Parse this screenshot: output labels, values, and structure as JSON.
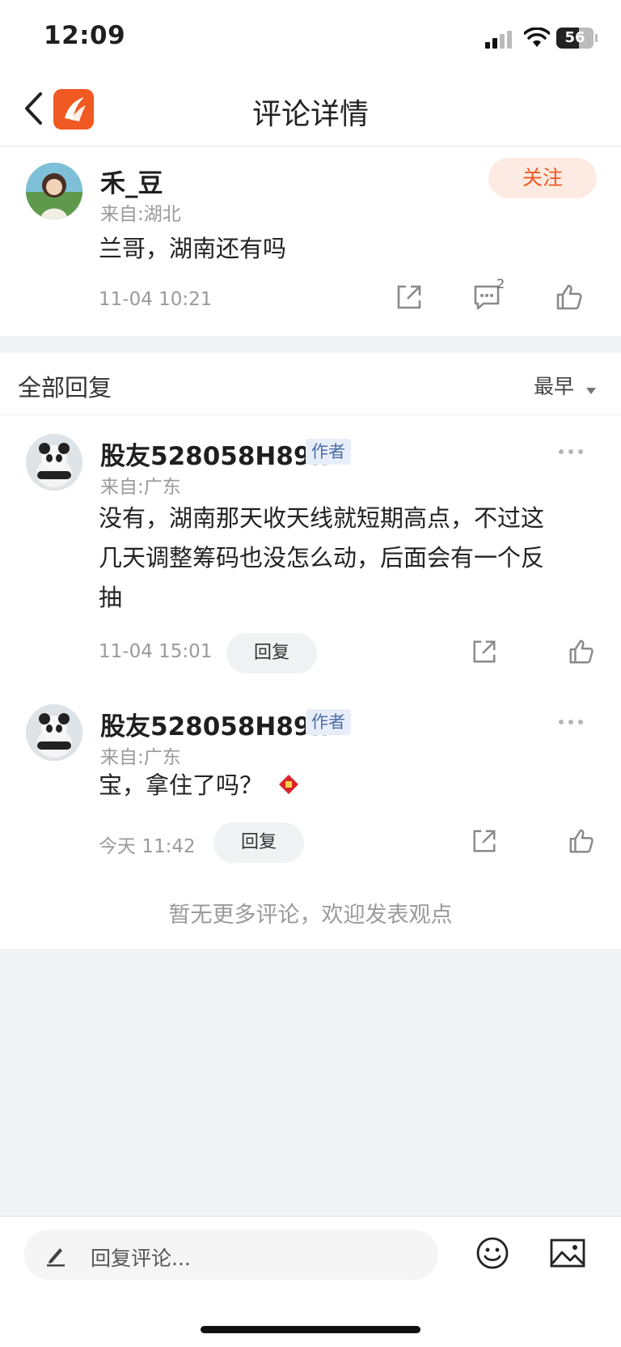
{
  "status_bar": {
    "time": "12:09",
    "battery": "56"
  },
  "header": {
    "title": "评论详情"
  },
  "main_comment": {
    "username": "禾_豆",
    "location": "来自:湖北",
    "follow_label": "关注",
    "text": "兰哥，湖南还有吗",
    "timestamp": "11-04 10:21",
    "reply_count": "2"
  },
  "replies_section": {
    "title": "全部回复",
    "sort_label": "最早"
  },
  "replies": [
    {
      "username": "股友528058H89h",
      "badge": "作者",
      "location": "来自:广东",
      "text_lines": [
        "没有，湖南那天收天线就短期高点，不过这",
        "几天调整筹码也没怎么动，后面会有一个反",
        "抽"
      ],
      "timestamp": "11-04 15:01",
      "reply_label": "回复"
    },
    {
      "username": "股友528058H89h",
      "badge": "作者",
      "location": "来自:广东",
      "text": "宝，拿住了吗？",
      "timestamp": "今天 11:42",
      "reply_label": "回复"
    }
  ],
  "footer_note": "暂无更多评论，欢迎发表观点",
  "bottom_bar": {
    "placeholder": "回复评论..."
  },
  "colors": {
    "accent": "#f05a22",
    "follow_bg": "#fdebe3",
    "badge_bg": "#e8eef9",
    "badge_text": "#4b6ea8"
  }
}
